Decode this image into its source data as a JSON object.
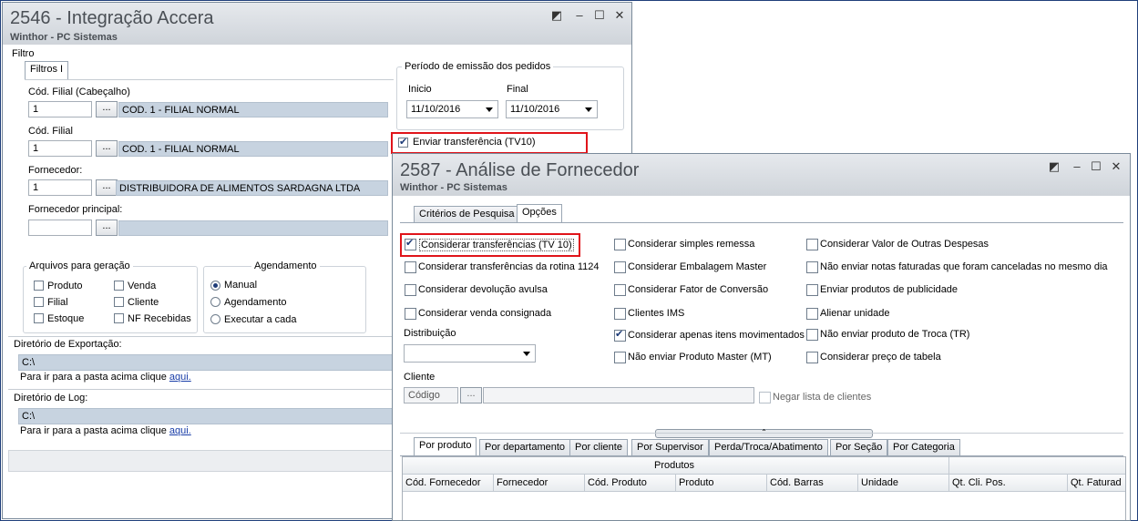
{
  "win1": {
    "title": "2546 - Integração Accera",
    "subtitle": "Winthor - PC Sistemas",
    "filtro_label": "Filtro",
    "tab_filtros": "Filtros I",
    "cod_filial_cab_label": "Cód. Filial (Cabeçalho)",
    "cod_filial_cab_value": "1",
    "cod_filial_cab_desc": "COD. 1 - FILIAL NORMAL",
    "cod_filial_label": "Cód. Filial",
    "cod_filial_value": "1",
    "cod_filial_desc": "COD. 1 - FILIAL NORMAL",
    "fornecedor_label": "Fornecedor:",
    "fornecedor_value": "1",
    "fornecedor_desc": "DISTRIBUIDORA DE ALIMENTOS SARDAGNA LTDA",
    "fornecedor_principal_label": "Fornecedor principal:",
    "dots": "...",
    "periodo_label": "Período de emissão dos pedidos",
    "inicio_label": "Inicio",
    "inicio_value": "11/10/2016",
    "final_label": "Final",
    "final_value": "11/10/2016",
    "enviar_transferencia": "Enviar transferência (TV10)",
    "arquivos_label": "Arquivos para geração",
    "arquivos": [
      "Produto",
      "Venda",
      "Filial",
      "Cliente",
      "Estoque",
      "NF Recebidas"
    ],
    "agendamento_label": "Agendamento",
    "agendamento": [
      "Manual",
      "Agendamento",
      "Executar a cada"
    ],
    "dir_export_label": "Diretório de Exportação:",
    "dir_export_value": "C:\\",
    "dir_hint": "Para ir para a pasta acima clique",
    "dir_link": "aqui.",
    "dir_log_label": "Diretório de Log:",
    "dir_log_value": "C:\\"
  },
  "win2": {
    "title": "2587 - Análise de Fornecedor",
    "subtitle": "Winthor - PC Sistemas",
    "tabs": [
      "Critérios de Pesquisa",
      "Opções"
    ],
    "col1": [
      "Considerar transferências (TV 10)",
      "Considerar transferências da rotina 1124",
      "Considerar devolução avulsa",
      "Considerar venda consignada"
    ],
    "col1_checked": [
      true,
      false,
      false,
      false
    ],
    "col2": [
      "Considerar simples remessa",
      "Considerar Embalagem Master",
      "Considerar Fator de Conversão",
      "Clientes IMS",
      "Considerar apenas itens movimentados",
      "Não enviar Produto Master (MT)"
    ],
    "col2_checked": [
      false,
      false,
      false,
      false,
      true,
      false
    ],
    "col3": [
      "Considerar Valor de Outras Despesas",
      "Não enviar notas faturadas que foram canceladas no mesmo dia",
      "Enviar produtos de publicidade",
      "Alienar unidade",
      "Não enviar produto de Troca (TR)",
      "Considerar preço de tabela"
    ],
    "col3_checked": [
      false,
      false,
      false,
      false,
      false,
      false
    ],
    "distribuicao_label": "Distribuição",
    "cliente_label": "Cliente",
    "codigo_placeholder": "Código",
    "dots": "...",
    "negar_label": "Negar lista de clientes",
    "bottom_tabs": [
      "Por produto",
      "Por departamento",
      "Por cliente",
      "Por Supervisor",
      "Perda/Troca/Abatimento",
      "Por Seção",
      "Por Categoria"
    ],
    "grid_title": "Produtos",
    "columns": [
      "Cód. Fornecedor",
      "Fornecedor",
      "Cód. Produto",
      "Produto",
      "Cód. Barras",
      "Unidade",
      "Qt. Cli. Pos.",
      "Qt. Faturad"
    ]
  }
}
